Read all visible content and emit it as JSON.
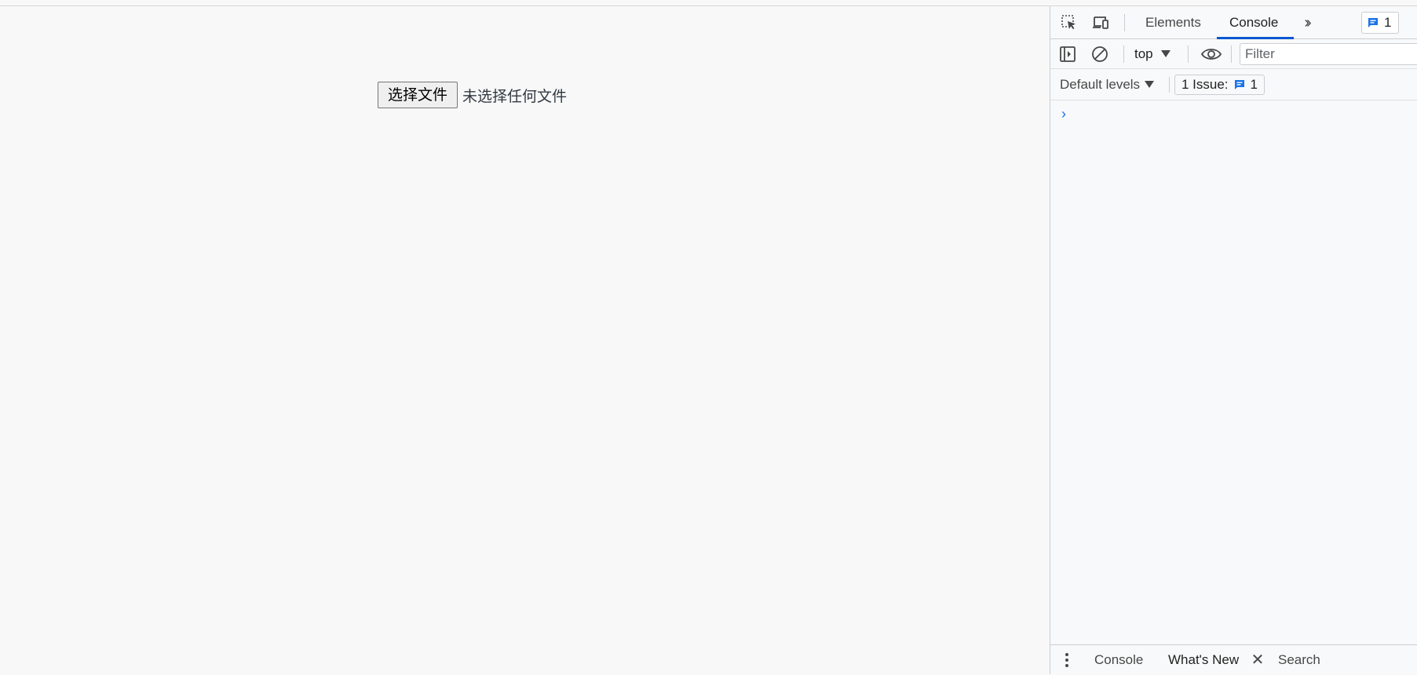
{
  "page": {
    "file_button_label": "选择文件",
    "file_status": "未选择任何文件"
  },
  "devtools": {
    "tabs": [
      {
        "label": "Elements",
        "active": false
      },
      {
        "label": "Console",
        "active": true
      }
    ],
    "more_tabs_icon": "chevron-double-right-icon",
    "issues_count_top": "1",
    "toolbar": {
      "context": "top",
      "filter_placeholder": "Filter",
      "levels_label": "Default levels",
      "issues_label": "1 Issue:",
      "issues_count": "1"
    },
    "console_prompt": "›",
    "drawer_tabs": [
      {
        "label": "Console"
      },
      {
        "label": "What's New",
        "active": true,
        "closable": true
      },
      {
        "label": "Search"
      }
    ],
    "colors": {
      "accent": "#0b57d0",
      "issue_icon": "#1a73e8"
    }
  }
}
